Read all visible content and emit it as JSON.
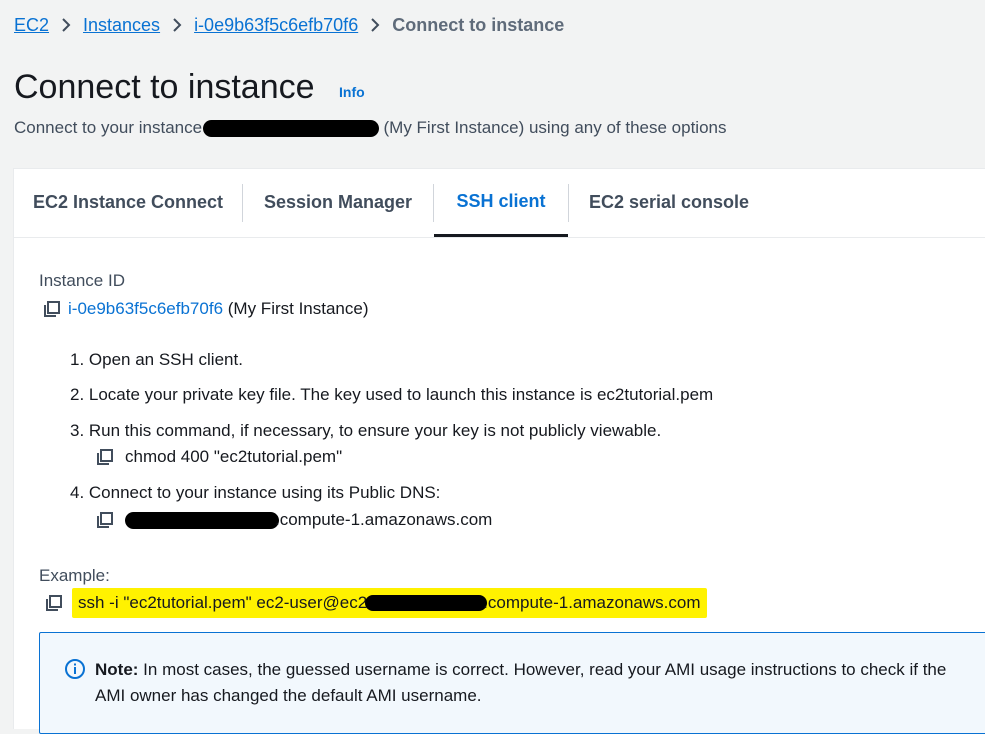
{
  "breadcrumb": {
    "items": [
      "EC2",
      "Instances",
      "i-0e9b63f5c6efb70f6"
    ],
    "current": "Connect to instance"
  },
  "header": {
    "title": "Connect to instance",
    "info": "Info",
    "subtitle_prefix": "Connect to your instance ",
    "subtitle_suffix": " (My First Instance) using any of these options"
  },
  "tabs": [
    "EC2 Instance Connect",
    "Session Manager",
    "SSH client",
    "EC2 serial console"
  ],
  "active_tab": "SSH client",
  "instance": {
    "label": "Instance ID",
    "id": "i-0e9b63f5c6efb70f6",
    "name": "(My First Instance)"
  },
  "steps": {
    "s1": "1. Open an SSH client.",
    "s2": "2. Locate your private key file. The key used to launch this instance is ec2tutorial.pem",
    "s3": "3. Run this command, if necessary, to ensure your key is not publicly viewable.",
    "s3_cmd": "chmod 400 \"ec2tutorial.pem\"",
    "s4": "4. Connect to your instance using its Public DNS:",
    "s4_dns_suffix": ".compute-1.amazonaws.com"
  },
  "example": {
    "label": "Example:",
    "cmd_prefix": "ssh -i \"ec2tutorial.pem\" ec2-user@ec2",
    "cmd_suffix": ".compute-1.amazonaws.com"
  },
  "note": {
    "bold": "Note:",
    "text": " In most cases, the guessed username is correct. However, read your AMI usage instructions to check if the AMI owner has changed the default AMI username."
  },
  "colors": {
    "link": "#0972d3",
    "highlight": "#fff200",
    "active_tab_underline": "#16191f"
  },
  "icons": [
    "chevron-right-icon",
    "copy-icon",
    "info-circle-icon"
  ]
}
